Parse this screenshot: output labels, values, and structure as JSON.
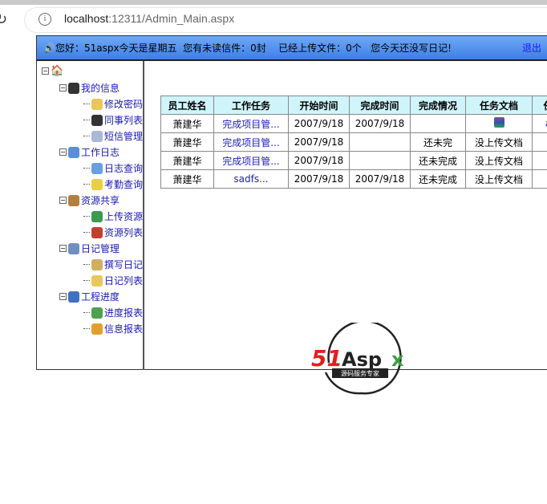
{
  "browser": {
    "url_host": "localhost",
    "url_rest": ":12311/Admin_Main.aspx"
  },
  "header": {
    "greeting": "您好：51aspx今天是星期五  您有未读信件：0封    已经上传文件：0个   您今天还没写日记!",
    "logout": "退出"
  },
  "tree": [
    {
      "label": "我的信息",
      "level": 1,
      "icon": "user-icon",
      "color": "#333"
    },
    {
      "label": "修改密码",
      "level": 2,
      "icon": "folder-icon",
      "color": "#e8c85a"
    },
    {
      "label": "同事列表",
      "level": 2,
      "icon": "users-icon",
      "color": "#333"
    },
    {
      "label": "短信管理",
      "level": 2,
      "icon": "mail-icon",
      "color": "#aab8d8"
    },
    {
      "label": "工作日志",
      "level": 1,
      "icon": "computer-icon",
      "color": "#5a8fd8"
    },
    {
      "label": "日志查询",
      "level": 2,
      "icon": "document-icon",
      "color": "#6aa0e0"
    },
    {
      "label": "考勤查询",
      "level": 2,
      "icon": "clock-icon",
      "color": "#e8d040"
    },
    {
      "label": "资源共享",
      "level": 1,
      "icon": "share-icon",
      "color": "#b08040"
    },
    {
      "label": "上传资源",
      "level": 2,
      "icon": "globe-icon",
      "color": "#3a9a50"
    },
    {
      "label": "资源列表",
      "level": 2,
      "icon": "download-icon",
      "color": "#c04030"
    },
    {
      "label": "日记管理",
      "level": 1,
      "icon": "edit-icon",
      "color": "#7090c0"
    },
    {
      "label": "撰写日记",
      "level": 2,
      "icon": "write-icon",
      "color": "#d0b060"
    },
    {
      "label": "日记列表",
      "level": 2,
      "icon": "folder-icon",
      "color": "#e8c85a"
    },
    {
      "label": "工程进度",
      "level": 1,
      "icon": "chart-icon",
      "color": "#4070c0"
    },
    {
      "label": "进度报表",
      "level": 2,
      "icon": "report-icon",
      "color": "#50a050"
    },
    {
      "label": "信息报表",
      "level": 2,
      "icon": "chat-icon",
      "color": "#e0a030"
    }
  ],
  "table": {
    "headers": [
      "员工姓名",
      "工作任务",
      "开始时间",
      "完成时间",
      "完成情况",
      "任务文档",
      "任"
    ],
    "rows": [
      [
        "萧建华",
        "完成项目管...",
        "2007/9/18",
        "2007/9/18",
        "",
        "[book]",
        "a"
      ],
      [
        "萧建华",
        "完成项目管...",
        "2007/9/18",
        "",
        "还未完",
        "没上传文档",
        ""
      ],
      [
        "萧建华",
        "完成项目管...",
        "2007/9/18",
        "",
        "还未完成",
        "没上传文档",
        ""
      ],
      [
        "萧建华",
        "sadfs...",
        "2007/9/18",
        "2007/9/18",
        "还未完成",
        "没上传文档",
        ""
      ]
    ]
  },
  "logo": {
    "text": "51Aspx",
    "tagline": "源码服务专家"
  }
}
